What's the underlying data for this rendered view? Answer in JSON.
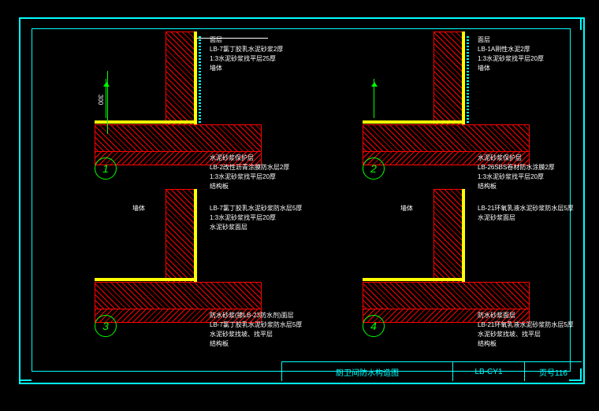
{
  "title_block": {
    "drawing_title": "厨卫间防水构造图",
    "drawing_code": "LB-CY1",
    "page_number": "页号116"
  },
  "circles": {
    "n1": "1",
    "n2": "2",
    "n3": "3",
    "n4": "4"
  },
  "detail1": {
    "wall_label": "墙体",
    "layers": [
      "面层",
      "LB-7氯丁胶乳水泥砂浆2厚",
      "1:3水泥砂浆找平层25厚",
      "墙体"
    ],
    "floor_layers": [
      "水泥砂浆保护层",
      "LB-2改性沥青涂膜防水层2厚",
      "1:3水泥砂浆找平层20厚",
      "结构板"
    ]
  },
  "detail2": {
    "wall_label": "墙体",
    "layers": [
      "面层",
      "LB-1A刚性水泥2厚",
      "1:3水泥砂浆找平层20厚",
      "墙体"
    ],
    "floor_layers": [
      "水泥砂浆保护层",
      "LB-26SBS卷材防水涂膜2厚",
      "1:3水泥砂浆找平层20厚",
      "结构板"
    ]
  },
  "detail3": {
    "wall_label": "墙体",
    "layers": [
      "LB-7氯丁胶乳水泥砂浆防水层5厚",
      "1:3水泥砂浆找平层20厚",
      "水泥砂浆面层"
    ],
    "floor_layers": [
      "防水砂浆(掺LB-23防水剂)面层",
      "LB-7氯丁胶乳水泥砂浆防水层5厚",
      "水泥砂浆找坡、找平层",
      "结构板"
    ]
  },
  "detail4": {
    "wall_label": "墙体",
    "layers": [
      "LB-21环氧乳液水泥砂浆防水层5厚",
      "水泥砂浆面层"
    ],
    "floor_layers": [
      "防水砂浆面层",
      "LB-21环氧乳液水泥砂浆防水层5厚",
      "水泥砂浆找坡、找平层",
      "结构板"
    ]
  },
  "dimension_label": "300"
}
